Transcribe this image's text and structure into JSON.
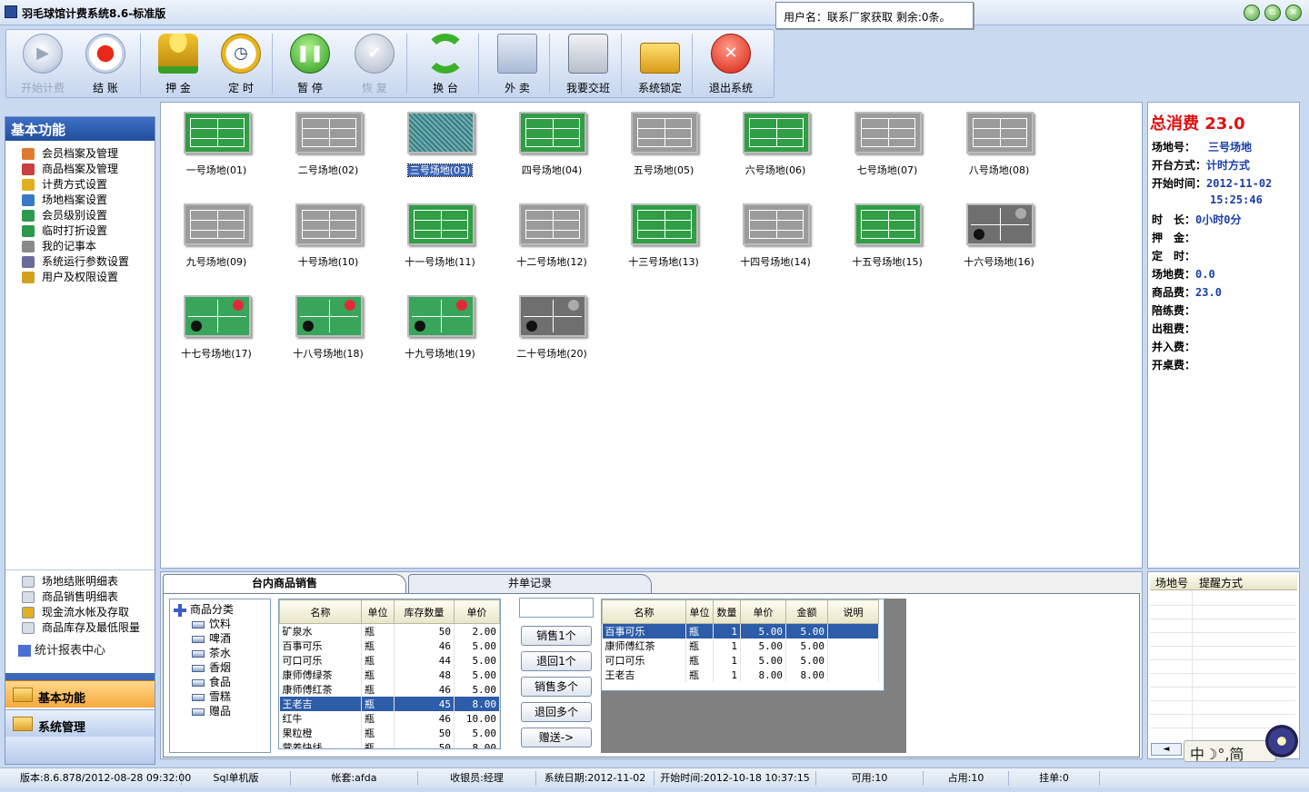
{
  "window": {
    "title": "羽毛球馆计费系统8.6-标准版",
    "user_box": "用户名：联系厂家获取 剩余:0条。"
  },
  "toolbar": [
    {
      "label": "开始计费",
      "icon": "play-icon",
      "disabled": true
    },
    {
      "label": "结 账",
      "icon": "record-icon",
      "disabled": false
    },
    {
      "label": "押 金",
      "icon": "coins-icon",
      "disabled": false
    },
    {
      "label": "定 时",
      "icon": "clock-icon",
      "disabled": false
    },
    {
      "label": "暂 停",
      "icon": "pause-icon",
      "disabled": false
    },
    {
      "label": "恢 复",
      "icon": "check-icon",
      "disabled": true
    },
    {
      "label": "换 台",
      "icon": "refresh-icon",
      "disabled": false
    },
    {
      "label": "外 卖",
      "icon": "shopping-bag-icon",
      "disabled": false
    },
    {
      "label": "我要交班",
      "icon": "cash-register-icon",
      "disabled": false
    },
    {
      "label": "系统锁定",
      "icon": "lock-icon",
      "disabled": false
    },
    {
      "label": "退出系统",
      "icon": "exit-icon",
      "disabled": false
    }
  ],
  "left": {
    "header": "基本功能",
    "menu": [
      "会员档案及管理",
      "商品档案及管理",
      "计费方式设置",
      "场地档案设置",
      "会员级别设置",
      "临时打折设置",
      "我的记事本",
      "系统运行参数设置",
      "用户及权限设置"
    ],
    "reports": [
      "场地结账明细表",
      "商品销售明细表",
      "现金流水帐及存取",
      "商品库存及最低限量"
    ],
    "report_center": "统计报表中心",
    "nav_basic": "基本功能",
    "nav_system": "系统管理"
  },
  "courts": [
    {
      "name": "一号场地(01)",
      "type": "badminton",
      "state": "active"
    },
    {
      "name": "二号场地(02)",
      "type": "badminton",
      "state": "idle"
    },
    {
      "name": "三号场地(03)",
      "type": "badminton",
      "state": "selected"
    },
    {
      "name": "四号场地(04)",
      "type": "badminton",
      "state": "active"
    },
    {
      "name": "五号场地(05)",
      "type": "badminton",
      "state": "idle"
    },
    {
      "name": "六号场地(06)",
      "type": "badminton",
      "state": "active"
    },
    {
      "name": "七号场地(07)",
      "type": "badminton",
      "state": "idle"
    },
    {
      "name": "八号场地(08)",
      "type": "badminton",
      "state": "idle"
    },
    {
      "name": "九号场地(09)",
      "type": "badminton",
      "state": "idle"
    },
    {
      "name": "十号场地(10)",
      "type": "badminton",
      "state": "idle"
    },
    {
      "name": "十一号场地(11)",
      "type": "badminton",
      "state": "active"
    },
    {
      "name": "十二号场地(12)",
      "type": "badminton",
      "state": "idle"
    },
    {
      "name": "十三号场地(13)",
      "type": "badminton",
      "state": "active"
    },
    {
      "name": "十四号场地(14)",
      "type": "badminton",
      "state": "idle"
    },
    {
      "name": "十五号场地(15)",
      "type": "badminton",
      "state": "active"
    },
    {
      "name": "十六号场地(16)",
      "type": "table-tennis",
      "state": "idle"
    },
    {
      "name": "十七号场地(17)",
      "type": "table-tennis",
      "state": "active"
    },
    {
      "name": "十八号场地(18)",
      "type": "table-tennis",
      "state": "active"
    },
    {
      "name": "十九号场地(19)",
      "type": "table-tennis",
      "state": "active"
    },
    {
      "name": "二十号场地(20)",
      "type": "table-tennis",
      "state": "idle"
    }
  ],
  "info": {
    "total": "总消费 23.0",
    "rows": [
      {
        "label": "场地号：",
        "value": "三号场地"
      },
      {
        "label": "开台方式：",
        "value": "计时方式"
      },
      {
        "label": "开始时间：",
        "value": "2012-11-02"
      },
      {
        "label": "",
        "value": "15:25:46"
      },
      {
        "label": "时　长：",
        "value": "0小时0分"
      },
      {
        "label": "押　金：",
        "value": ""
      },
      {
        "label": "定　时：",
        "value": ""
      },
      {
        "label": "场地费：",
        "value": "0.0"
      },
      {
        "label": "商品费：",
        "value": "23.0"
      },
      {
        "label": "陪练费：",
        "value": ""
      },
      {
        "label": "出租费：",
        "value": ""
      },
      {
        "label": "并入费：",
        "value": ""
      },
      {
        "label": "开桌费：",
        "value": ""
      }
    ]
  },
  "tabs": {
    "sales": "台内商品销售",
    "merge": "并单记录"
  },
  "tree": {
    "root": "商品分类",
    "children": [
      "饮料",
      "啤酒",
      "茶水",
      "香烟",
      "食品",
      "雪糕",
      "赠品"
    ]
  },
  "goods": {
    "headers": [
      "名称",
      "单位",
      "库存数量",
      "单价"
    ],
    "rows": [
      [
        "矿泉水",
        "瓶",
        "50",
        "2.00"
      ],
      [
        "百事可乐",
        "瓶",
        "46",
        "5.00"
      ],
      [
        "可口可乐",
        "瓶",
        "44",
        "5.00"
      ],
      [
        "康师傅绿茶",
        "瓶",
        "48",
        "5.00"
      ],
      [
        "康师傅红茶",
        "瓶",
        "46",
        "5.00"
      ],
      [
        "王老吉",
        "瓶",
        "45",
        "8.00"
      ],
      [
        "红牛",
        "瓶",
        "46",
        "10.00"
      ],
      [
        "果粒橙",
        "瓶",
        "50",
        "5.00"
      ],
      [
        "营养快线",
        "瓶",
        "50",
        "8.00"
      ]
    ],
    "selected_row": 5
  },
  "actions": [
    "销售1个",
    "退回1个",
    "销售多个",
    "退回多个",
    "赠送->"
  ],
  "qty_value": "",
  "order": {
    "headers": [
      "名称",
      "单位",
      "数量",
      "单价",
      "金额",
      "说明"
    ],
    "rows": [
      [
        "百事可乐",
        "瓶",
        "1",
        "5.00",
        "5.00",
        ""
      ],
      [
        "康师傅红茶",
        "瓶",
        "1",
        "5.00",
        "5.00",
        ""
      ],
      [
        "可口可乐",
        "瓶",
        "1",
        "5.00",
        "5.00",
        ""
      ],
      [
        "王老吉",
        "瓶",
        "1",
        "8.00",
        "8.00",
        ""
      ]
    ],
    "selected_row": 0
  },
  "remind": {
    "headers": [
      "场地号",
      "提醒方式"
    ]
  },
  "ime": "中☽°,简",
  "status": [
    "版本:8.6.878/2012-08-28 09:32:00",
    "Sql单机版",
    "帐套:afda",
    "收银员:经理",
    "系统日期:2012-11-02",
    "开始时间:2012-10-18 10:37:15",
    "可用:10",
    "占用:10",
    "挂单:0"
  ],
  "colors": {
    "accent": "#224f9e",
    "total": "#e01010",
    "value": "#1a3ea8",
    "active_court": "#2f9e45"
  }
}
